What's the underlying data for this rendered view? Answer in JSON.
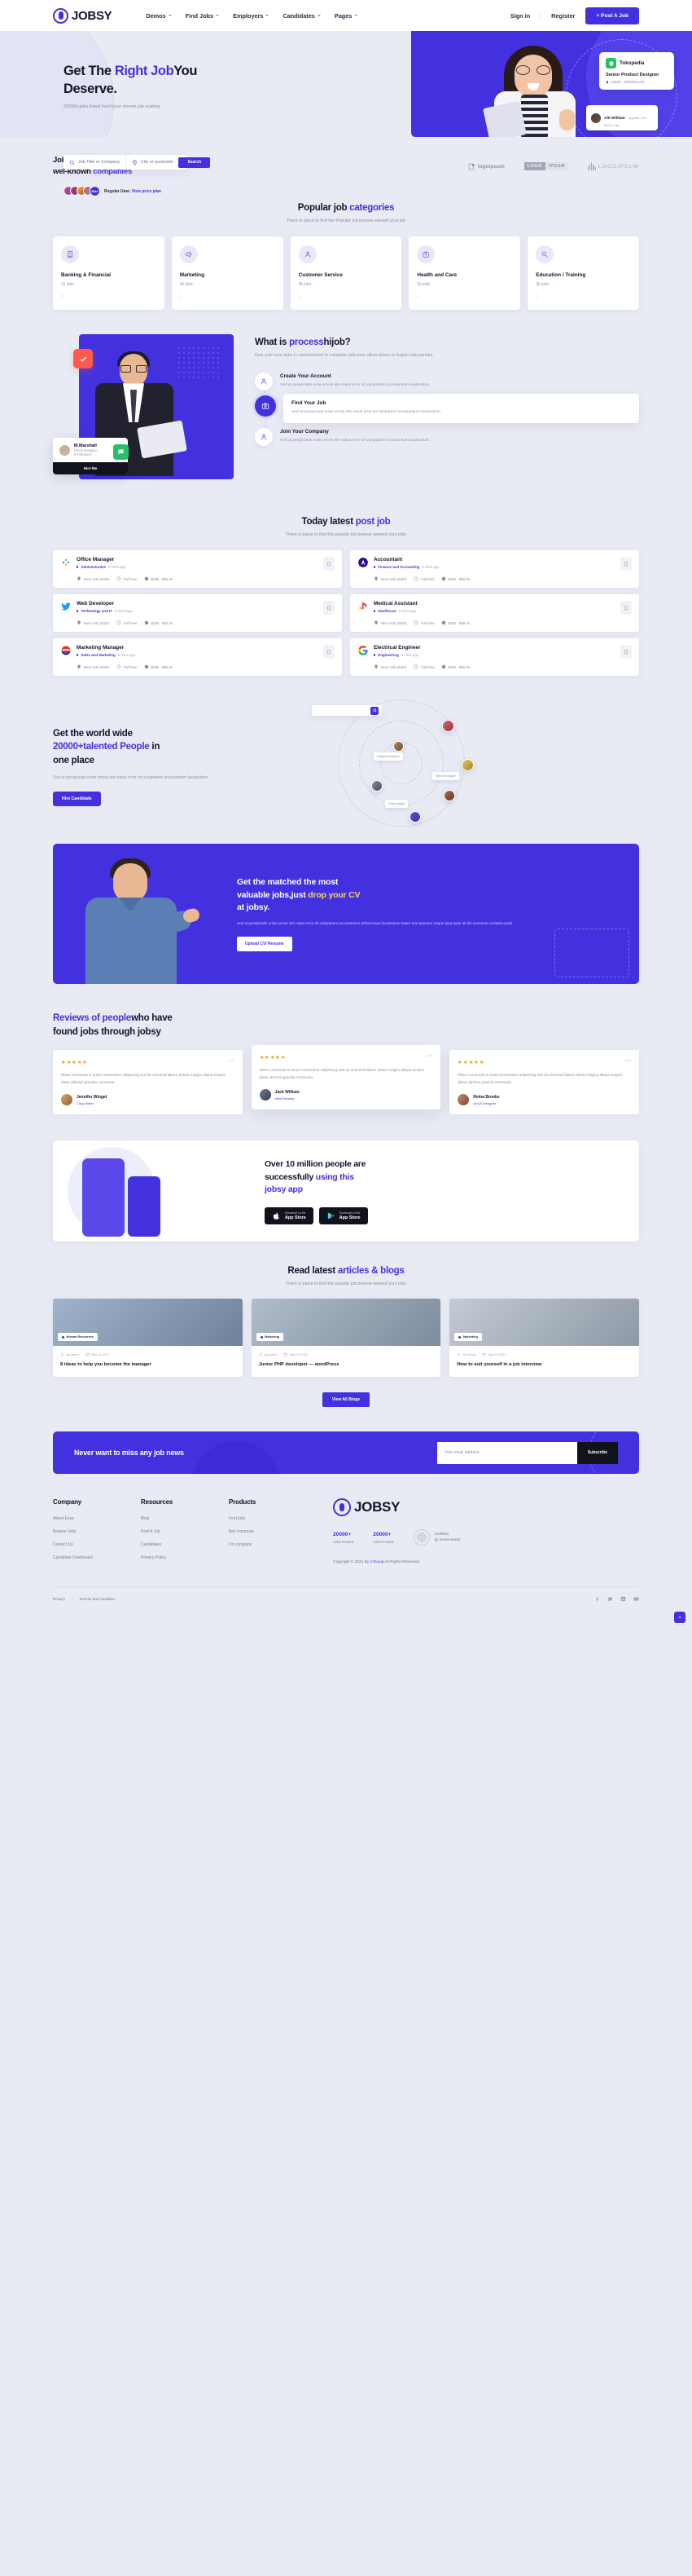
{
  "header": {
    "brand": "JOBSY",
    "nav": [
      {
        "label": "Demos",
        "caret": true
      },
      {
        "label": "Find Jobs",
        "caret": true
      },
      {
        "label": "Employers",
        "caret": true
      },
      {
        "label": "Candidates",
        "caret": true
      },
      {
        "label": "Pages",
        "caret": true
      }
    ],
    "signin": "Sign in",
    "register": "Register",
    "post_job": "+ Post A Job"
  },
  "hero": {
    "title_1": "Get The ",
    "title_accent": "Right Job",
    "title_2": "You",
    "title_3": "Deserve.",
    "subtitle": "25000+jobs listed here!your dream job waiting.",
    "search": {
      "job_placeholder": "Job Title or Company",
      "city_placeholder": "City or postcode",
      "button": "Search"
    },
    "users_text": "Regular User. ",
    "users_link": "View price plan",
    "avatar_count": "45k+",
    "card": {
      "company": "Tokopedia",
      "role": "Senior Product Designer",
      "salary": "12500 - 15000/month"
    },
    "card2": {
      "name": "Alit William",
      "meta": "applied / 4h",
      "sub": "UI/UX Job"
    }
  },
  "companies": {
    "title_1": "Job vacancies from",
    "title_2": "wel-known ",
    "title_accent": "companies",
    "logos": [
      "logoipsum",
      "LOGO",
      "IPSUM",
      "LOGOIPSUM"
    ]
  },
  "categories": {
    "title_1": "Popular job ",
    "title_accent": "categories",
    "subtitle": "There is place to find the Popular job,browse wanted your job",
    "items": [
      {
        "name": "Banking & Financial",
        "jobs": "1k jobs",
        "icon": "bank-icon"
      },
      {
        "name": "Marketing",
        "jobs": "2k jobs",
        "icon": "megaphone-icon"
      },
      {
        "name": "Customer Service",
        "jobs": "4k jobs",
        "icon": "headset-icon"
      },
      {
        "name": "Health and Care",
        "jobs": "1k jobs",
        "icon": "medkit-icon"
      },
      {
        "name": "Education / Training",
        "jobs": "2k jobs",
        "icon": "education-icon"
      }
    ]
  },
  "process": {
    "title_1": "What is ",
    "title_accent": "process",
    "title_2": "hijob?",
    "paragraph": "Duis aute irure dolor in reprehenderit in voluptate velit esse cillum dolore eu fugiat nulla pariatur.",
    "steps": [
      {
        "title": "Create Your Account",
        "desc": "Sed ut perspiciatis unde omnis iste natus error sit voluptatem accusantium laudantium."
      },
      {
        "title": "Find Your Job",
        "desc": "Sed ut perspiciatis unde omnis iste natus error sit voluptatem accusantium laudantium."
      },
      {
        "title": "Join Your Company",
        "desc": "Sed ut perspiciatis unde omnis iste natus error sit voluptatem accusantium laudantium."
      }
    ],
    "card": {
      "name": "M.Marshall",
      "role": "UI/UX Designer",
      "sub": "8 Followers",
      "button": "Hire Me"
    }
  },
  "latest_jobs": {
    "title_1": "Today latest ",
    "title_accent": "post job",
    "subtitle": "There is place to find the popular job,browse wanted your jobs",
    "items": [
      {
        "title": "Office Manager",
        "category": "Administrative",
        "time": "5 mins ago",
        "location": "New York,25321",
        "type": "Full time",
        "salary": "$25k - $50./m",
        "logo": "slack-icon"
      },
      {
        "title": "Accountant",
        "category": "Finance and Accounting",
        "time": "5 mins ago",
        "location": "New York,25321",
        "type": "Full time",
        "salary": "$25k - $50./m",
        "logo": "adobe-icon"
      },
      {
        "title": "Web Developer",
        "category": "Technology and IT",
        "time": "5 mins ago",
        "location": "New York,25321",
        "type": "Full time",
        "salary": "$25k - $50./m",
        "logo": "twitter-icon"
      },
      {
        "title": "Medical Assistant",
        "category": "Healthcare",
        "time": "5 mins ago",
        "location": "New York,25321",
        "type": "Full time",
        "salary": "$25k - $50./m",
        "logo": "playstation-icon"
      },
      {
        "title": "Marketing Manager",
        "category": "Sales and Marketing",
        "time": "5 mins ago",
        "location": "New York,25321",
        "type": "Full time",
        "salary": "$25k - $50./m",
        "logo": "pepsi-icon"
      },
      {
        "title": "Electrical Engineer",
        "category": "Engineering",
        "time": "5 mins ago",
        "location": "New York,25321",
        "type": "Full time",
        "salary": "$25k - $50./m",
        "logo": "google-icon"
      }
    ]
  },
  "talent": {
    "title_1": "Get the world wide",
    "title_accent": "20000+talented People",
    "title_2": " in",
    "title_3": "one place",
    "paragraph": "Sed ut perspiciatis unde omnis iste natus error sit voluptatem accusantium laudantium.",
    "button": "Hire Candidate",
    "search_placeholder": "",
    "chips": [
      "Graphic Designer",
      "Web Developer",
      "Data Analyst"
    ]
  },
  "cv": {
    "title_1": "Get the matched the most",
    "title_2": "valuable jobs,just ",
    "title_accent": "drop your CV",
    "title_3": "at jobsy.",
    "paragraph": "Sed ut perspiciatis unde omnis iste natus error sit voluptatem accusantium doloremque laudantium totam rem aperiam eaque ipsa quae ab illo inventore veritatis quasi.",
    "button": "Upload CV/ Resume"
  },
  "reviews": {
    "title_accent": "Reviews of people",
    "title_1": "who have",
    "title_2": "found jobs through jobsy",
    "items": [
      {
        "text": "Risus commodo is amet consectetur adipiscing sed do eiusmod labore dolore magna aliqua suspen disse ultricies gravida commodo.",
        "name": "Jennifer Winget",
        "role": "Copy Writer"
      },
      {
        "text": "Risus commodo is amet consectetur adipiscing sed do eiusmod labore dolore magna aliqua suspen disse ultricies gravida commodo.",
        "name": "Jack William",
        "role": "Web Security"
      },
      {
        "text": "Risus commodo is amet consectetur adipiscing sed do eiusmod labore dolore magna aliqua suspen disse ultricies gravida commodo.",
        "name": "Reina Brooks",
        "role": "UI/UX Designer"
      }
    ]
  },
  "app": {
    "title_1": "Over 10 million people are",
    "title_2": "successfully ",
    "title_accent": "using this",
    "title_3": "jobsy app",
    "badges": [
      {
        "small": "Download on the",
        "big": "App Store",
        "icon": "apple-icon"
      },
      {
        "small": "Download on the",
        "big": "App Store",
        "icon": "play-icon"
      }
    ]
  },
  "blogs": {
    "title_1": "Read latest ",
    "title_accent": "articles & blogs",
    "subtitle": "There is place to find the popular job,browse wanted your jobs",
    "view_all": "View All Blogs",
    "items": [
      {
        "tag": "Human Resources",
        "author": "By Admin",
        "date": "May 10,2021",
        "title": "8 ideas to help you become the manager"
      },
      {
        "tag": "Marketing",
        "author": "By Admin",
        "date": "May 10,2021",
        "title": "Junior PHP developer — wordPress"
      },
      {
        "tag": "Marketing",
        "author": "By Admin",
        "date": "May 10,2021",
        "title": "How to suit yourself in a job interview"
      }
    ]
  },
  "newsletter": {
    "title": "Never want to miss any job news",
    "placeholder": "Your email address",
    "button": "Subscribe"
  },
  "footer": {
    "columns": [
      {
        "heading": "Company",
        "links": [
          "About Eeza",
          "Browse Jobs",
          "Contact Us",
          "Candidate Dashboard"
        ]
      },
      {
        "heading": "Resources",
        "links": [
          "Blog",
          "Post A Job",
          "Candidates",
          "Privacy Policy"
        ]
      },
      {
        "heading": "Products",
        "links": [
          "Find jobs",
          "find compnies",
          "I'm company"
        ]
      }
    ],
    "brand": "JOBSY",
    "stats": [
      {
        "number": "20000+",
        "label": "Jobs Posted"
      },
      {
        "number": "20000+",
        "label": "Jobs Posted"
      }
    ],
    "cert_line1": "Certified",
    "cert_line2": "by Government",
    "copyright_pre": "Copyright © 2021 By ",
    "copyright_link": "17sucai",
    "copyright_post": ",All Rights Reserved.",
    "privacy": "Privacy",
    "terms": "Teorms and condition"
  },
  "colors": {
    "accent": "#4331e0",
    "dark": "#12121c",
    "page_bg": "#e8eaf4"
  }
}
